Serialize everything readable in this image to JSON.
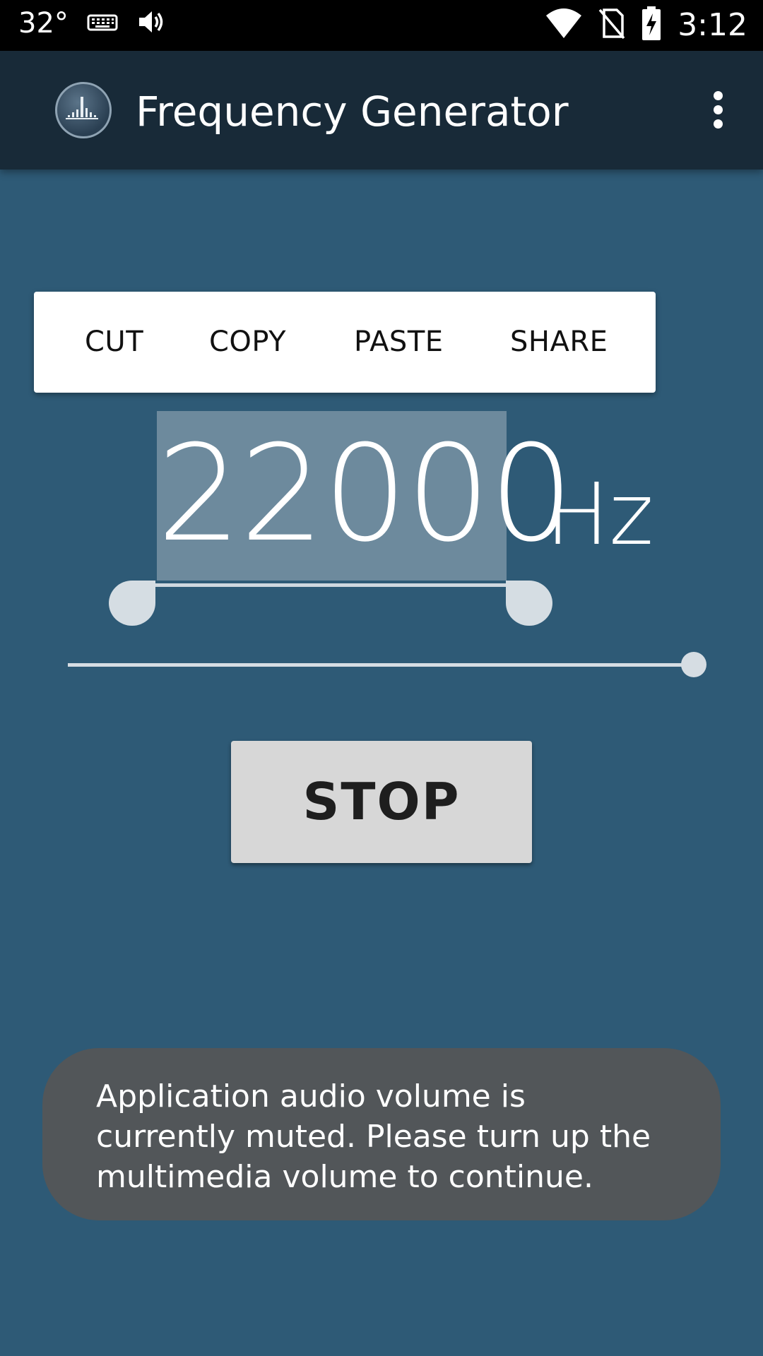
{
  "status_bar": {
    "temperature": "32°",
    "time": "3:12",
    "icons": [
      "keyboard-icon",
      "volume-icon",
      "wifi-icon",
      "no-sim-icon",
      "battery-charging-icon"
    ]
  },
  "app_bar": {
    "title": "Frequency Generator",
    "logo_icon": "spectrum-logo-icon",
    "menu_icon": "more-vert-icon"
  },
  "text_toolbar": {
    "cut": "CUT",
    "copy": "COPY",
    "paste": "PASTE",
    "share": "SHARE"
  },
  "frequency": {
    "value": "22000",
    "unit": "Hz"
  },
  "slider": {
    "level": 1.0
  },
  "stop_button": "STOP",
  "toast": {
    "message": "Application audio volume is currently muted. Please turn up the multimedia volume to continue."
  },
  "colors": {
    "background": "#2e5a76",
    "app_bar": "#182a38",
    "selection": "#6d8a9d",
    "toast": "#525659"
  }
}
